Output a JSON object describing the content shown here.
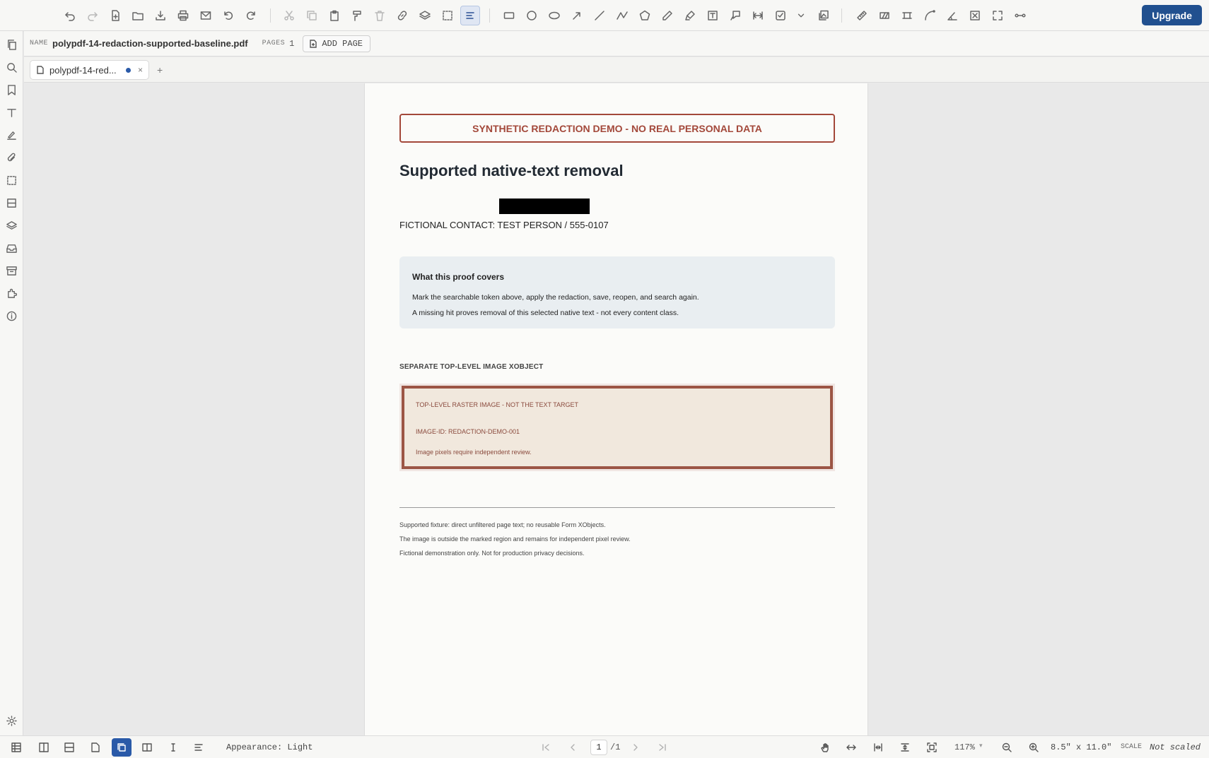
{
  "toolbar": {
    "upgrade_label": "Upgrade"
  },
  "filebar": {
    "name_label": "NAME",
    "file_name": "polypdf-14-redaction-supported-baseline.pdf",
    "pages_label": "PAGES",
    "page_count": "1",
    "add_page_label": "ADD PAGE"
  },
  "tabs": {
    "active_title": "polypdf-14-red...",
    "close_glyph": "×",
    "new_tab_glyph": "+"
  },
  "document": {
    "banner": "SYNTHETIC REDACTION DEMO - NO REAL PERSONAL DATA",
    "heading": "Supported native-text removal",
    "contact": "FICTIONAL CONTACT: TEST PERSON / 555-0107",
    "proof": {
      "title": "What this proof covers",
      "line1": "Mark the searchable token above, apply the redaction, save, reopen, and search again.",
      "line2": "A missing hit proves removal of this selected native text - not every content class."
    },
    "image_section_label": "SEPARATE TOP-LEVEL IMAGE XOBJECT",
    "image": {
      "line1": "TOP-LEVEL RASTER IMAGE - NOT THE TEXT TARGET",
      "line2": "IMAGE-ID: REDACTION-DEMO-001",
      "line3": "Image pixels require independent review."
    },
    "footer": {
      "line1": "Supported fixture: direct unfiltered page text; no reusable Form XObjects.",
      "line2": "The image is outside the marked region and remains for independent pixel review.",
      "line3": "Fictional demonstration only. Not for production privacy decisions."
    }
  },
  "statusbar": {
    "appearance": "Appearance: Light",
    "current_page": "1",
    "total_pages": "/1",
    "zoom": "117%",
    "page_size": "8.5\" x 11.0\"",
    "scale_label": "SCALE",
    "scale_value": "Not scaled"
  },
  "colors": {
    "accent": "#21508f",
    "banner_red": "#a3483a",
    "image_border": "#9c5545"
  }
}
